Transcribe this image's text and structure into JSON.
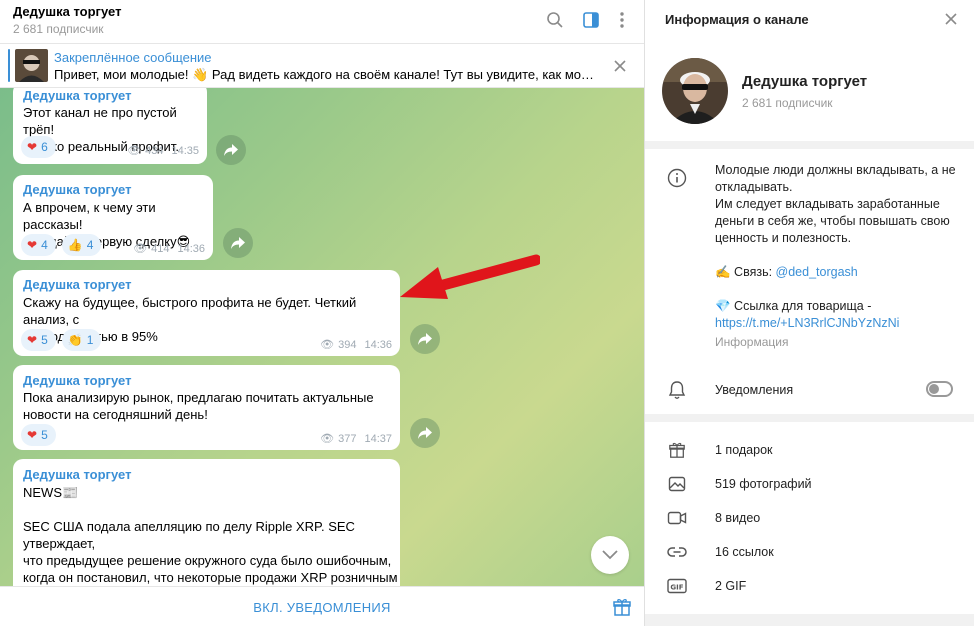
{
  "chat": {
    "title": "Дедушка торгует",
    "subscribers": "2 681 подписчик",
    "pinned_title": "Закреплённое сообщение",
    "pinned_text": "Привет, мои молодые! 👋 Рад видеть каждого на своём канале!  Тут вы увидите, как можно за...",
    "footer_button": "ВКЛ. УВЕДОМЛЕНИЯ",
    "messages": [
      {
        "author": "Дедушка торгует",
        "text": "Этот канал не про пустой трёп!\nТолько реальный профит.",
        "reactions": [
          {
            "emoji": "❤️",
            "count": "6"
          }
        ],
        "views": "434",
        "time": "14:35"
      },
      {
        "author": "Дедушка торгует",
        "text": "А впрочем, к чему эти рассказы!\nОжидайте первую сделку😎",
        "reactions": [
          {
            "emoji": "❤️",
            "count": "4"
          },
          {
            "emoji": "👍",
            "count": "4"
          }
        ],
        "views": "414",
        "time": "14:36"
      },
      {
        "author": "Дедушка торгует",
        "text": "Скажу на будущее, быстрого профита не будет. Четкий анализ, с\nпроходимостью в 95%",
        "reactions": [
          {
            "emoji": "❤️",
            "count": "5"
          },
          {
            "emoji": "👏",
            "count": "1"
          }
        ],
        "views": "394",
        "time": "14:36"
      },
      {
        "author": "Дедушка торгует",
        "text": "Пока анализирую рынок, предлагаю почитать актуальные\nновости на сегодняшний день!",
        "reactions": [
          {
            "emoji": "❤️",
            "count": "5"
          }
        ],
        "views": "377",
        "time": "14:37"
      },
      {
        "author": "Дедушка торгует",
        "text": "NEWS📰\n\nSEC США подала апелляцию по делу Ripple XRP. SEC утверждает,\nчто предыдущее решение окружного суда было ошибочным,\nкогда он постановил, что некоторые продажи XRP розничным\nинвесторам не нарушают законы о ценных бумагах. При этом\nкалифорнийский окружной Ripple заявил, что иск SEC, вероятно"
      }
    ]
  },
  "info": {
    "title": "Информация о канале",
    "name": "Дедушка торгует",
    "subscribers": "2 681 подписчик",
    "description_1": "Молодые люди должны вкладывать, а не откладывать.",
    "description_2": "Им следует вкладывать заработанные деньги в себя же, чтобы повышать свою ценность и полезность.",
    "contact_prefix": "✍️ Связь: ",
    "contact_handle": "@ded_torgash",
    "invite_prefix": "💎 Ссылка для товарища -",
    "invite_link": "https://t.me/+LN3RrlCJNbYzNzNi",
    "info_label": "Информация",
    "notifications_label": "Уведомления",
    "media": [
      {
        "icon": "gift-icon",
        "label": "1 подарок"
      },
      {
        "icon": "photo-icon",
        "label": "519 фотографий"
      },
      {
        "icon": "video-icon",
        "label": "8 видео"
      },
      {
        "icon": "link-icon",
        "label": "16 ссылок"
      },
      {
        "icon": "gif-icon",
        "label": "2 GIF"
      }
    ]
  },
  "colors": {
    "accent": "#3a8fd6",
    "arrow": "#e0151b",
    "heart": "#e53935"
  }
}
